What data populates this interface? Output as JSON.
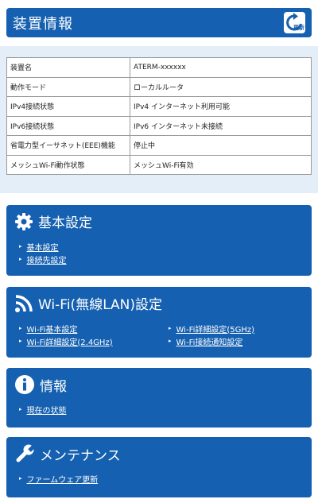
{
  "header": {
    "title": "装置情報",
    "refresh_label": "更新"
  },
  "device_info": [
    {
      "key": "装置名",
      "value": "ATERM-xxxxxx"
    },
    {
      "key": "動作モード",
      "value": "ローカルルータ"
    },
    {
      "key": "IPv4接続状態",
      "value": "IPv4 インターネット利用可能"
    },
    {
      "key": "IPv6接続状態",
      "value": "IPv6 インターネット未接続"
    },
    {
      "key": "省電力型イーサネット(EEE)機能",
      "value": "停止中"
    },
    {
      "key": "メッシュWi-Fi動作状態",
      "value": "メッシュWi-Fi有効"
    }
  ],
  "cards": {
    "basic": {
      "title": "基本設定",
      "icon": "gear-icon",
      "links": [
        "基本設定",
        "接続先設定"
      ]
    },
    "wifi": {
      "title": "Wi-Fi(無線LAN)設定",
      "icon": "wifi-icon",
      "links_left": [
        "Wi-Fi基本設定",
        "Wi-Fi詳細設定(2.4GHz)"
      ],
      "links_right": [
        "Wi-Fi詳細設定(5GHz)",
        "Wi-Fi接続通知設定"
      ]
    },
    "info": {
      "title": "情報",
      "icon": "info-icon",
      "links": [
        "現在の状態"
      ]
    },
    "maintenance": {
      "title": "メンテナンス",
      "icon": "wrench-icon",
      "links": [
        "ファームウェア更新"
      ]
    }
  },
  "colors": {
    "accent": "#1560b0",
    "panel_bg": "#e4eef8"
  }
}
